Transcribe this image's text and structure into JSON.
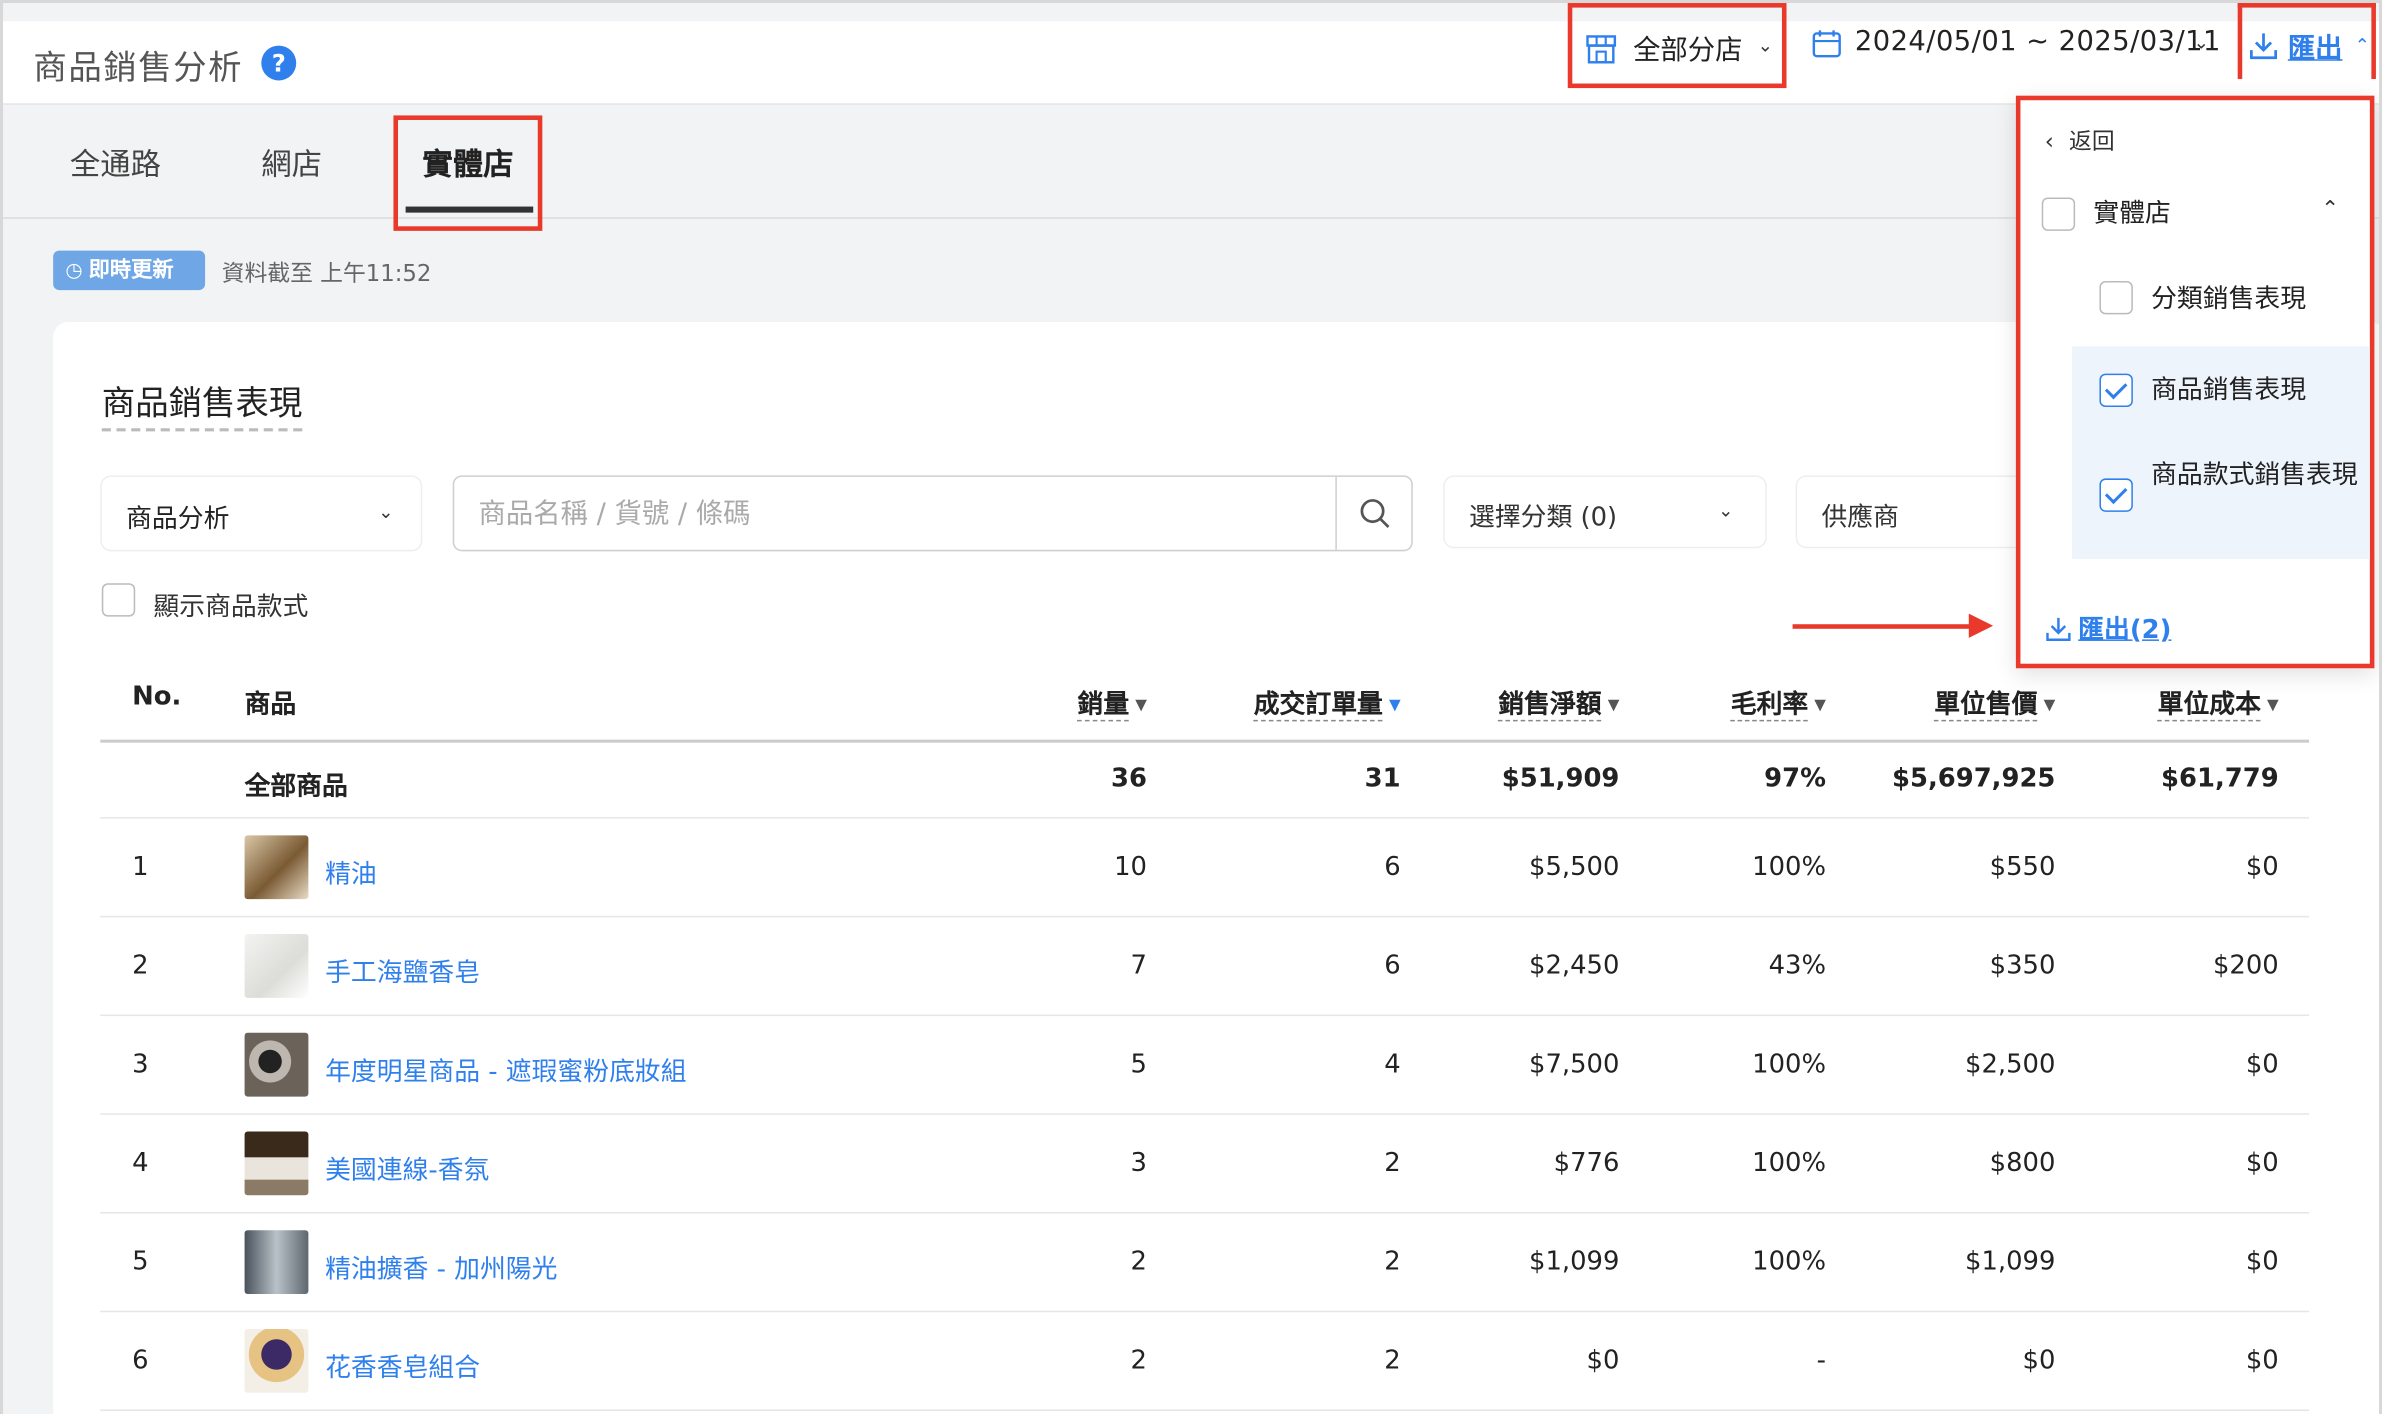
{
  "header": {
    "page_title": "商品銷售分析",
    "help": "?",
    "store_filter": "全部分店",
    "date_range": "2024/05/01 ~ 2025/03/11",
    "export_label": "匯出"
  },
  "tabs": [
    {
      "label": "全通路",
      "active": false
    },
    {
      "label": "網店",
      "active": false
    },
    {
      "label": "實體店",
      "active": true
    }
  ],
  "status": {
    "live_badge": "即時更新",
    "data_time": "資料截至 上午11:52"
  },
  "card": {
    "title": "商品銷售表現",
    "analysis_select": "商品分析",
    "search_placeholder": "商品名稱 / 貨號 / 條碼",
    "category_select": "選擇分類 (0)",
    "supplier_select": "供應商",
    "show_variants_label": "顯示商品款式"
  },
  "table": {
    "columns": {
      "no": "No.",
      "product": "商品",
      "qty": "銷量",
      "orders": "成交訂單量",
      "net_sales": "銷售淨額",
      "margin": "毛利率",
      "unit_price": "單位售價",
      "unit_cost": "單位成本"
    },
    "total": {
      "label": "全部商品",
      "qty": "36",
      "orders": "31",
      "net_sales": "$51,909",
      "margin": "97%",
      "unit_price": "$5,697,925",
      "unit_cost": "$61,779"
    },
    "rows": [
      {
        "no": "1",
        "name": "精油",
        "qty": "10",
        "orders": "6",
        "net_sales": "$5,500",
        "margin": "100%",
        "unit_price": "$550",
        "unit_cost": "$0"
      },
      {
        "no": "2",
        "name": "手工海鹽香皂",
        "qty": "7",
        "orders": "6",
        "net_sales": "$2,450",
        "margin": "43%",
        "unit_price": "$350",
        "unit_cost": "$200"
      },
      {
        "no": "3",
        "name": "年度明星商品 - 遮瑕蜜粉底妝組",
        "qty": "5",
        "orders": "4",
        "net_sales": "$7,500",
        "margin": "100%",
        "unit_price": "$2,500",
        "unit_cost": "$0"
      },
      {
        "no": "4",
        "name": "美國連線-香氛",
        "qty": "3",
        "orders": "2",
        "net_sales": "$776",
        "margin": "100%",
        "unit_price": "$800",
        "unit_cost": "$0"
      },
      {
        "no": "5",
        "name": "精油擴香 - 加州陽光",
        "qty": "2",
        "orders": "2",
        "net_sales": "$1,099",
        "margin": "100%",
        "unit_price": "$1,099",
        "unit_cost": "$0"
      },
      {
        "no": "6",
        "name": "花香香皂組合",
        "qty": "2",
        "orders": "2",
        "net_sales": "$0",
        "margin": "-",
        "unit_price": "$0",
        "unit_cost": "$0"
      }
    ]
  },
  "export_panel": {
    "back": "返回",
    "group_label": "實體店",
    "options": [
      {
        "label": "分類銷售表現",
        "checked": false
      },
      {
        "label": "商品銷售表現",
        "checked": true
      },
      {
        "label": "商品款式銷售表現",
        "checked": true
      }
    ],
    "export_count": "匯出(2)"
  },
  "colors": {
    "accent_blue": "#2f80ed",
    "highlight_red": "#e8392b"
  }
}
